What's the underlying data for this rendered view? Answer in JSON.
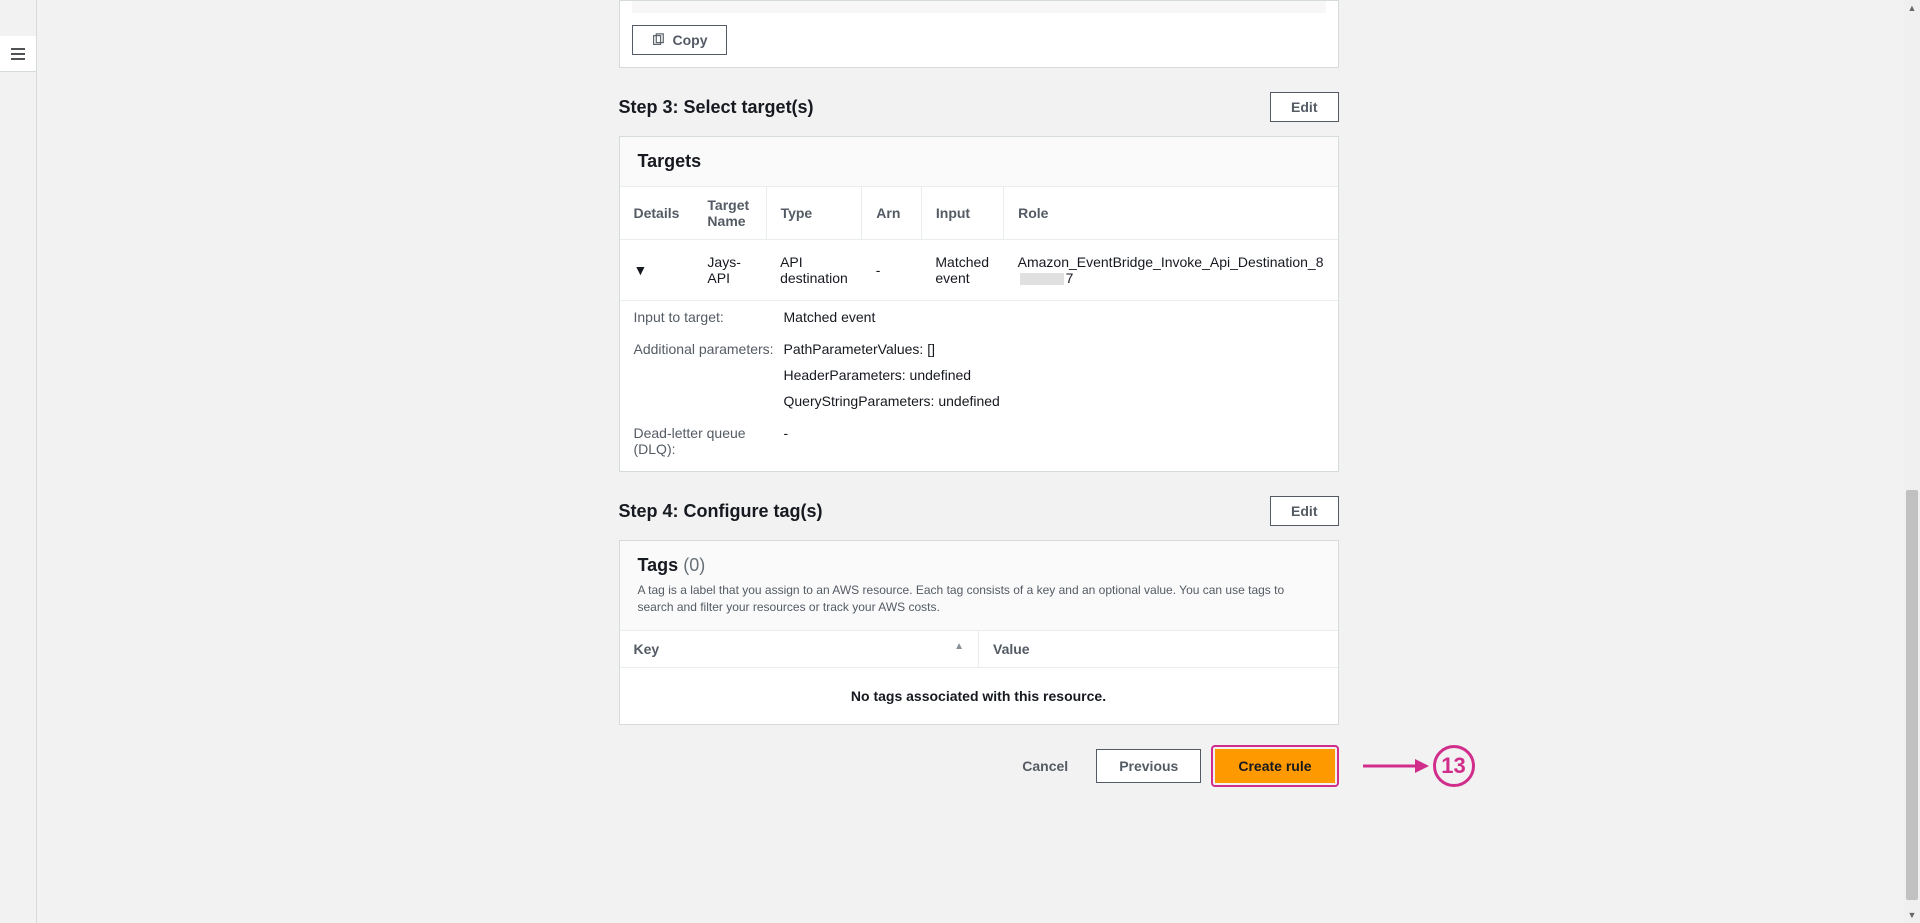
{
  "copy_label": "Copy",
  "step3": {
    "title": "Step 3: Select target(s)",
    "edit": "Edit",
    "panel_title": "Targets",
    "columns": [
      "Details",
      "Target Name",
      "Type",
      "Arn",
      "Input",
      "Role"
    ],
    "row": {
      "target_name": "Jays-API",
      "type": "API destination",
      "arn": "-",
      "input": "Matched event",
      "role_pre": "Amazon_EventBridge_Invoke_Api_Destination_8",
      "role_suf": "7"
    },
    "details": {
      "input_to_target_label": "Input to target:",
      "input_to_target_value": "Matched event",
      "additional_params_label": "Additional parameters:",
      "path_params": "PathParameterValues: []",
      "header_params": "HeaderParameters: undefined",
      "query_params": "QueryStringParameters: undefined",
      "dlq_label": "Dead-letter queue (DLQ):",
      "dlq_value": "-"
    }
  },
  "step4": {
    "title": "Step 4: Configure tag(s)",
    "edit": "Edit",
    "panel_title": "Tags",
    "count": "(0)",
    "desc": "A tag is a label that you assign to an AWS resource. Each tag consists of a key and an optional value. You can use tags to search and filter your resources or track your AWS costs.",
    "columns": {
      "key": "Key",
      "value": "Value"
    },
    "empty": "No tags associated with this resource."
  },
  "footer": {
    "cancel": "Cancel",
    "previous": "Previous",
    "create": "Create rule"
  },
  "annotation": {
    "number": "13"
  }
}
